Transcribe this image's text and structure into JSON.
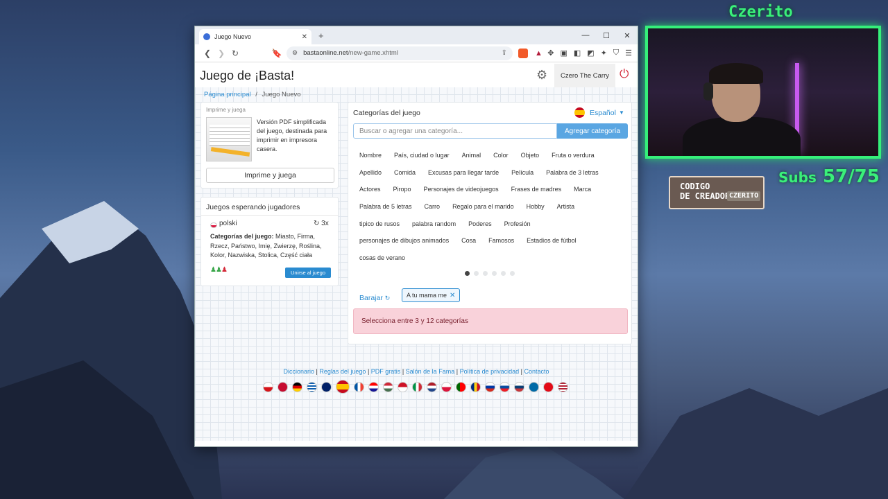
{
  "browser": {
    "tab_title": "Juego Nuevo",
    "url_domain": "bastaonline.net",
    "url_path": "/new-game.xhtml"
  },
  "header": {
    "title": "Juego de ¡Basta!",
    "username": "Czero The Carry"
  },
  "breadcrumb": {
    "home": "Página principal",
    "separator": "/",
    "current": "Juego Nuevo"
  },
  "print_card": {
    "label": "Imprime y juega",
    "description": "Versión PDF simplificada del juego, destinada para imprimir en impresora casera.",
    "button": "Imprime y juega"
  },
  "waiting": {
    "heading": "Juegos esperando jugadores",
    "game": {
      "language": "polski",
      "rounds": "3x",
      "categories_label": "Categorías del juego:",
      "categories": "Miasto, Firma, Rzecz, Państwo, Imię, Zwierzę, Roślina, Kolor, Nazwiska, Stolica, Część ciała",
      "join_button": "Unirse al juego"
    }
  },
  "categories": {
    "heading": "Categorías del juego",
    "language": "Español",
    "search_placeholder": "Buscar o agregar una categoría...",
    "add_button": "Agregar categoría",
    "rows": [
      [
        "Nombre",
        "País, ciudad o lugar",
        "Animal",
        "Color",
        "Objeto",
        "Fruta o verdura"
      ],
      [
        "Apellido",
        "Comida",
        "Excusas para llegar tarde",
        "Película",
        "Palabra de 3 letras"
      ],
      [
        "Actores",
        "Piropo",
        "Personajes de videojuegos",
        "Frases de madres",
        "Marca"
      ],
      [
        "Palabra de 5 letras",
        "Carro",
        "Regalo para el marido",
        "Hobby",
        "Artista"
      ],
      [
        "tipico de rusos",
        "palabra random",
        "Poderes",
        "Profesión"
      ],
      [
        "personajes de dibujos animados",
        "Cosa",
        "Famosos",
        "Estadios de fútbol"
      ],
      [
        "cosas de verano"
      ]
    ],
    "shuffle": "Barajar",
    "selected": [
      "A tu mama me"
    ],
    "alert": "Selecciona entre 3 y 12 categorías"
  },
  "footer": {
    "links": [
      "Diccionario",
      "Reglas del juego",
      "PDF gratis",
      "Salón de la Fama",
      "Política de privacidad",
      "Contacto"
    ]
  },
  "overlay": {
    "streamer": "Czerito",
    "code_line1": "CODIGO",
    "code_line2": "DE CREADOR",
    "code_tag": "CZERITO",
    "subs_label": "Subs",
    "subs_count": "57/75"
  }
}
